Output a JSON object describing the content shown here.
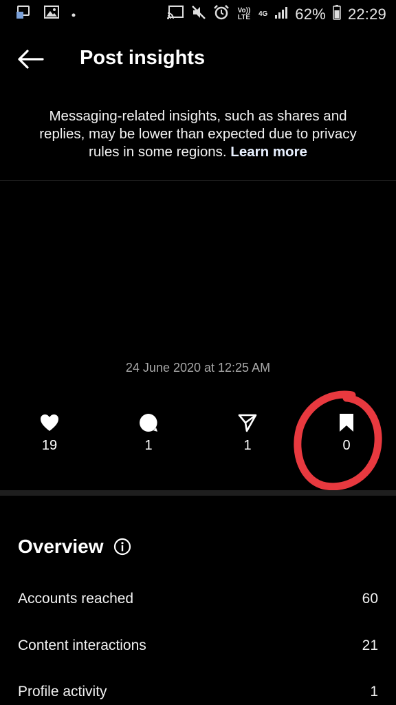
{
  "status_bar": {
    "battery": "62%",
    "time": "22:29",
    "volte_label": "Vo)) LTE",
    "network": "4G"
  },
  "header": {
    "title": "Post insights"
  },
  "notice": {
    "text": "Messaging-related insights, such as shares and replies, may be lower than expected due to privacy rules in some regions.",
    "link_label": "Learn more"
  },
  "post": {
    "timestamp": "24 June 2020 at 12:25 AM"
  },
  "stats": {
    "likes": "19",
    "comments": "1",
    "shares": "1",
    "saves": "0"
  },
  "overview": {
    "title": "Overview",
    "rows": [
      {
        "label": "Accounts reached",
        "value": "60"
      },
      {
        "label": "Content interactions",
        "value": "21"
      },
      {
        "label": "Profile activity",
        "value": "1"
      }
    ]
  },
  "colors": {
    "background": "#000000",
    "annotation": "#e8393f"
  }
}
